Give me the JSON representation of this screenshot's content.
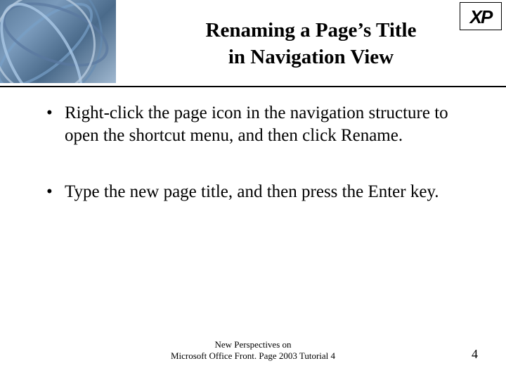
{
  "header": {
    "xp_label": "XP",
    "title_line1": "Renaming a Page’s Title",
    "title_line2": "in Navigation View"
  },
  "bullets": [
    "Right-click the page icon in the navigation structure to open the shortcut menu, and then click Rename.",
    "Type the new page title, and then press the Enter key."
  ],
  "footer": {
    "line1": "New Perspectives on",
    "line2": "Microsoft Office Front. Page 2003 Tutorial 4",
    "page_number": "4"
  }
}
